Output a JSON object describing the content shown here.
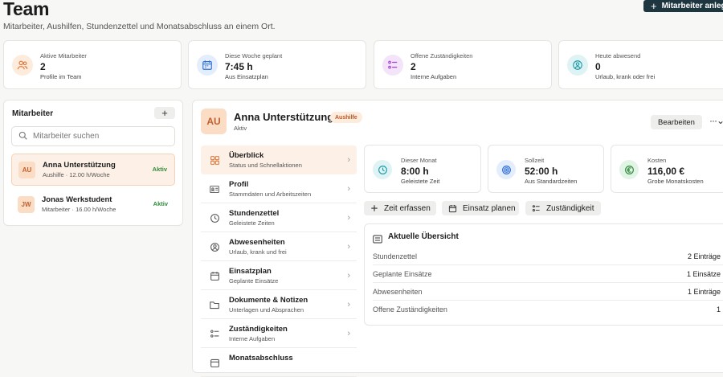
{
  "header": {
    "title": "Team",
    "subtitle": "Mitarbeiter, Aushilfen, Stundenzettel und Monatsabschluss an einem Ort.",
    "add_button": "Mitarbeiter anlegen"
  },
  "stats": [
    {
      "label": "Aktive Mitarbeiter",
      "value": "2",
      "sub": "Profile im Team",
      "icon": "users-icon",
      "color": "#e0763a"
    },
    {
      "label": "Diese Woche geplant",
      "value": "7:45 h",
      "sub": "Aus Einsatzplan",
      "icon": "calendar-icon",
      "color": "#2e6fd9"
    },
    {
      "label": "Offene Zuständigkeiten",
      "value": "2",
      "sub": "Interne Aufgaben",
      "icon": "tasklist-icon",
      "color": "#a63fd0"
    },
    {
      "label": "Heute abwesend",
      "value": "0",
      "sub": "Urlaub, krank oder frei",
      "icon": "absence-icon",
      "color": "#1f9ca8"
    }
  ],
  "sidebar": {
    "title": "Mitarbeiter",
    "add_label": "+",
    "search_placeholder": "Mitarbeiter suchen",
    "employees": [
      {
        "initials": "AU",
        "name": "Anna Unterstützung",
        "meta": "Aushilfe · 12.00 h/Woche",
        "status": "Aktiv"
      },
      {
        "initials": "JW",
        "name": "Jonas Werkstudent",
        "meta": "Mitarbeiter · 16.00 h/Woche",
        "status": "Aktiv"
      }
    ]
  },
  "detail": {
    "initials": "AU",
    "name": "Anna Unterstützung",
    "badge": "Aushilfe",
    "status": "Aktiv",
    "edit_label": "Bearbeiten",
    "more_label": "···",
    "nav": [
      {
        "label": "Überblick",
        "sub": "Status und Schnellaktionen",
        "icon": "grid-icon"
      },
      {
        "label": "Profil",
        "sub": "Stammdaten und Arbeitszeiten",
        "icon": "id-card-icon"
      },
      {
        "label": "Stundenzettel",
        "sub": "Geleistete Zeiten",
        "icon": "clock-icon"
      },
      {
        "label": "Abwesenheiten",
        "sub": "Urlaub, krank und frei",
        "icon": "absence-icon"
      },
      {
        "label": "Einsatzplan",
        "sub": "Geplante Einsätze",
        "icon": "calendar-icon"
      },
      {
        "label": "Dokumente & Notizen",
        "sub": "Unterlagen und Absprachen",
        "icon": "folder-icon"
      },
      {
        "label": "Zuständigkeiten",
        "sub": "Interne Aufgaben",
        "icon": "tasklist-icon"
      },
      {
        "label": "Monatsabschluss",
        "sub": "",
        "icon": "document-icon"
      }
    ],
    "kpis": [
      {
        "label": "Dieser Monat",
        "value": "8:00 h",
        "sub": "Geleistete Zeit",
        "icon": "clock-icon",
        "color": "#1f9ca8"
      },
      {
        "label": "Sollzeit",
        "value": "52:00 h",
        "sub": "Aus Standardzeiten",
        "icon": "target-icon",
        "color": "#2e6fd9"
      },
      {
        "label": "Kosten",
        "value": "116,00 €",
        "sub": "Grobe Monatskosten",
        "icon": "euro-icon",
        "color": "#2e8b3a"
      }
    ],
    "actions": [
      {
        "label": "Zeit erfassen",
        "icon": "plus-icon"
      },
      {
        "label": "Einsatz planen",
        "icon": "calendar-icon"
      },
      {
        "label": "Zuständigkeit",
        "icon": "tasklist-icon"
      }
    ],
    "overview": {
      "title": "Aktuelle Übersicht",
      "rows": [
        {
          "label": "Stundenzettel",
          "value": "2 Einträge"
        },
        {
          "label": "Geplante Einsätze",
          "value": "1 Einsätze"
        },
        {
          "label": "Abwesenheiten",
          "value": "1 Einträge"
        },
        {
          "label": "Offene Zuständigkeiten",
          "value": "1"
        }
      ]
    }
  }
}
